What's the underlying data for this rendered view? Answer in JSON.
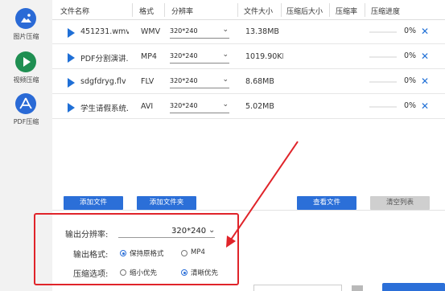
{
  "sidebar": {
    "items": [
      {
        "label": "图片压缩",
        "icon": "image-icon"
      },
      {
        "label": "视频压缩",
        "icon": "play-icon"
      },
      {
        "label": "PDF压缩",
        "icon": "pdf-icon"
      }
    ]
  },
  "table": {
    "headers": [
      "文件名称",
      "格式",
      "分辨率",
      "文件大小",
      "压缩后大小",
      "压缩率",
      "压缩进度"
    ],
    "rows": [
      {
        "name": "451231.wmv",
        "format": "WMV",
        "resolution": "320*240",
        "size": "13.38MB",
        "progress": "0%",
        "progress_value": 0
      },
      {
        "name": "PDF分割演讲...",
        "format": "MP4",
        "resolution": "320*240",
        "size": "1019.90KE",
        "progress": "0%",
        "progress_value": 0
      },
      {
        "name": "sdgfdryg.flv",
        "format": "FLV",
        "resolution": "320*240",
        "size": "8.68MB",
        "progress": "0%",
        "progress_value": 0
      },
      {
        "name": "学生请假系统...",
        "format": "AVI",
        "resolution": "320*240",
        "size": "5.02MB",
        "progress": "0%",
        "progress_value": 0
      }
    ]
  },
  "buttons": {
    "add_file": "添加文件",
    "add_folder": "添加文件夹",
    "view_files": "查看文件",
    "clear_list": "清空列表"
  },
  "options": {
    "resolution_label": "输出分辨率:",
    "resolution_value": "320*240",
    "format_label": "输出格式:",
    "format_options": [
      "保持原格式",
      "MP4"
    ],
    "format_selected": "保持原格式",
    "compress_label": "压缩选项:",
    "compress_options": [
      "缩小优先",
      "清晰优先"
    ],
    "compress_selected": "清晰优先"
  },
  "colors": {
    "accent": "#2b6fd8",
    "highlight_box": "#e0242a",
    "disabled": "#cccccc"
  }
}
